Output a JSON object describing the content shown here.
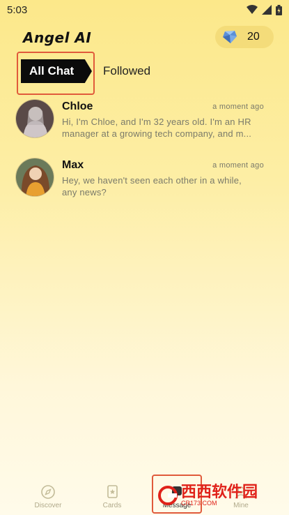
{
  "status_bar": {
    "time": "5:03"
  },
  "header": {
    "title": "Angel AI",
    "gem_count": "20"
  },
  "tabs": {
    "all_chat": "All Chat",
    "followed": "Followed"
  },
  "chats": [
    {
      "name": "Chloe",
      "time": "a moment ago",
      "preview_line1": "Hi, I'm Chloe, and I'm 32 years old. I'm an HR",
      "preview_line2": "manager at a growing tech company, and m..."
    },
    {
      "name": "Max",
      "time": "a moment ago",
      "preview_line1": "Hey, we haven't seen each other in a while,",
      "preview_line2": "any news?"
    }
  ],
  "nav": {
    "discover": "Discover",
    "cards": "Cards",
    "message": "Message",
    "mine": "Mine"
  },
  "watermark": {
    "text": "西西软件园",
    "sub": "CR173.COM"
  },
  "colors": {
    "accent_highlight": "#e05a3b",
    "tab_active_bg": "#0b0b0b",
    "background_top": "#fce88a"
  }
}
